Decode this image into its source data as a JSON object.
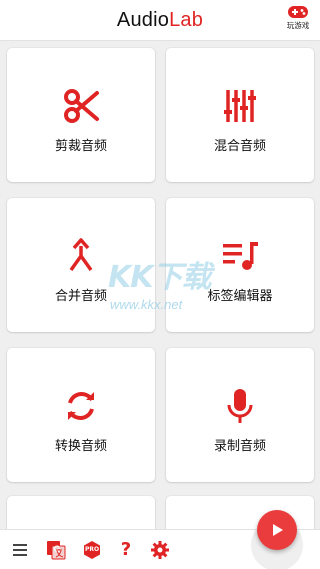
{
  "header": {
    "title_part1": "Audio",
    "title_part2": "Lab",
    "game_label": "玩游戏"
  },
  "tools": [
    {
      "label": "剪裁音频",
      "icon": "scissors-icon"
    },
    {
      "label": "混合音频",
      "icon": "mixer-sliders-icon"
    },
    {
      "label": "合并音频",
      "icon": "merge-arrow-icon"
    },
    {
      "label": "标签编辑器",
      "icon": "tag-list-music-icon"
    },
    {
      "label": "转换音频",
      "icon": "convert-sync-icon"
    },
    {
      "label": "录制音频",
      "icon": "microphone-icon"
    }
  ],
  "watermark": {
    "big": "KK下载",
    "small": "www.kkx.net"
  },
  "bottom_bar": {
    "items": [
      "menu-icon",
      "translate-icon",
      "pro-badge-icon",
      "help-icon",
      "settings-gear-icon"
    ],
    "pro_text": "PRO",
    "help_text": "?"
  },
  "colors": {
    "accent": "#e02424",
    "fab": "#ea3c3c"
  }
}
